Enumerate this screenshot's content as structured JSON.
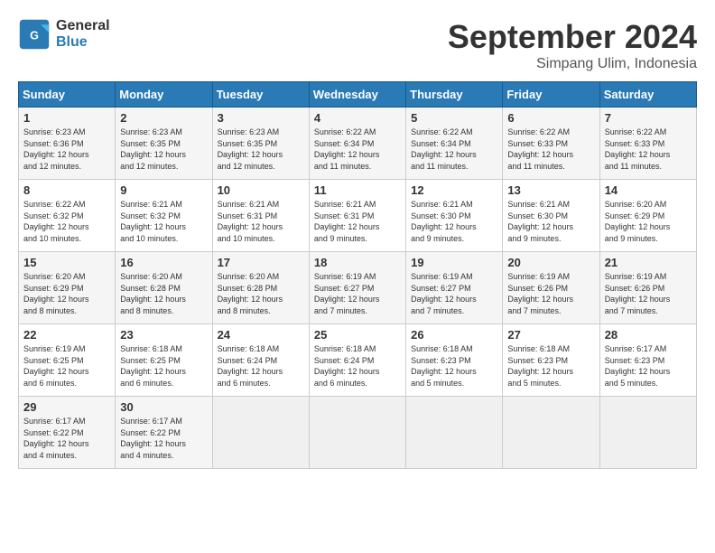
{
  "header": {
    "logo_line1": "General",
    "logo_line2": "Blue",
    "month": "September 2024",
    "location": "Simpang Ulim, Indonesia"
  },
  "days_of_week": [
    "Sunday",
    "Monday",
    "Tuesday",
    "Wednesday",
    "Thursday",
    "Friday",
    "Saturday"
  ],
  "weeks": [
    [
      {
        "day": "1",
        "sunrise": "6:23 AM",
        "sunset": "6:36 PM",
        "daylight": "12 hours and 12 minutes."
      },
      {
        "day": "2",
        "sunrise": "6:23 AM",
        "sunset": "6:35 PM",
        "daylight": "12 hours and 12 minutes."
      },
      {
        "day": "3",
        "sunrise": "6:23 AM",
        "sunset": "6:35 PM",
        "daylight": "12 hours and 12 minutes."
      },
      {
        "day": "4",
        "sunrise": "6:22 AM",
        "sunset": "6:34 PM",
        "daylight": "12 hours and 11 minutes."
      },
      {
        "day": "5",
        "sunrise": "6:22 AM",
        "sunset": "6:34 PM",
        "daylight": "12 hours and 11 minutes."
      },
      {
        "day": "6",
        "sunrise": "6:22 AM",
        "sunset": "6:33 PM",
        "daylight": "12 hours and 11 minutes."
      },
      {
        "day": "7",
        "sunrise": "6:22 AM",
        "sunset": "6:33 PM",
        "daylight": "12 hours and 11 minutes."
      }
    ],
    [
      {
        "day": "8",
        "sunrise": "6:22 AM",
        "sunset": "6:32 PM",
        "daylight": "12 hours and 10 minutes."
      },
      {
        "day": "9",
        "sunrise": "6:21 AM",
        "sunset": "6:32 PM",
        "daylight": "12 hours and 10 minutes."
      },
      {
        "day": "10",
        "sunrise": "6:21 AM",
        "sunset": "6:31 PM",
        "daylight": "12 hours and 10 minutes."
      },
      {
        "day": "11",
        "sunrise": "6:21 AM",
        "sunset": "6:31 PM",
        "daylight": "12 hours and 9 minutes."
      },
      {
        "day": "12",
        "sunrise": "6:21 AM",
        "sunset": "6:30 PM",
        "daylight": "12 hours and 9 minutes."
      },
      {
        "day": "13",
        "sunrise": "6:21 AM",
        "sunset": "6:30 PM",
        "daylight": "12 hours and 9 minutes."
      },
      {
        "day": "14",
        "sunrise": "6:20 AM",
        "sunset": "6:29 PM",
        "daylight": "12 hours and 9 minutes."
      }
    ],
    [
      {
        "day": "15",
        "sunrise": "6:20 AM",
        "sunset": "6:29 PM",
        "daylight": "12 hours and 8 minutes."
      },
      {
        "day": "16",
        "sunrise": "6:20 AM",
        "sunset": "6:28 PM",
        "daylight": "12 hours and 8 minutes."
      },
      {
        "day": "17",
        "sunrise": "6:20 AM",
        "sunset": "6:28 PM",
        "daylight": "12 hours and 8 minutes."
      },
      {
        "day": "18",
        "sunrise": "6:19 AM",
        "sunset": "6:27 PM",
        "daylight": "12 hours and 7 minutes."
      },
      {
        "day": "19",
        "sunrise": "6:19 AM",
        "sunset": "6:27 PM",
        "daylight": "12 hours and 7 minutes."
      },
      {
        "day": "20",
        "sunrise": "6:19 AM",
        "sunset": "6:26 PM",
        "daylight": "12 hours and 7 minutes."
      },
      {
        "day": "21",
        "sunrise": "6:19 AM",
        "sunset": "6:26 PM",
        "daylight": "12 hours and 7 minutes."
      }
    ],
    [
      {
        "day": "22",
        "sunrise": "6:19 AM",
        "sunset": "6:25 PM",
        "daylight": "12 hours and 6 minutes."
      },
      {
        "day": "23",
        "sunrise": "6:18 AM",
        "sunset": "6:25 PM",
        "daylight": "12 hours and 6 minutes."
      },
      {
        "day": "24",
        "sunrise": "6:18 AM",
        "sunset": "6:24 PM",
        "daylight": "12 hours and 6 minutes."
      },
      {
        "day": "25",
        "sunrise": "6:18 AM",
        "sunset": "6:24 PM",
        "daylight": "12 hours and 6 minutes."
      },
      {
        "day": "26",
        "sunrise": "6:18 AM",
        "sunset": "6:23 PM",
        "daylight": "12 hours and 5 minutes."
      },
      {
        "day": "27",
        "sunrise": "6:18 AM",
        "sunset": "6:23 PM",
        "daylight": "12 hours and 5 minutes."
      },
      {
        "day": "28",
        "sunrise": "6:17 AM",
        "sunset": "6:23 PM",
        "daylight": "12 hours and 5 minutes."
      }
    ],
    [
      {
        "day": "29",
        "sunrise": "6:17 AM",
        "sunset": "6:22 PM",
        "daylight": "12 hours and 4 minutes."
      },
      {
        "day": "30",
        "sunrise": "6:17 AM",
        "sunset": "6:22 PM",
        "daylight": "12 hours and 4 minutes."
      },
      null,
      null,
      null,
      null,
      null
    ]
  ]
}
